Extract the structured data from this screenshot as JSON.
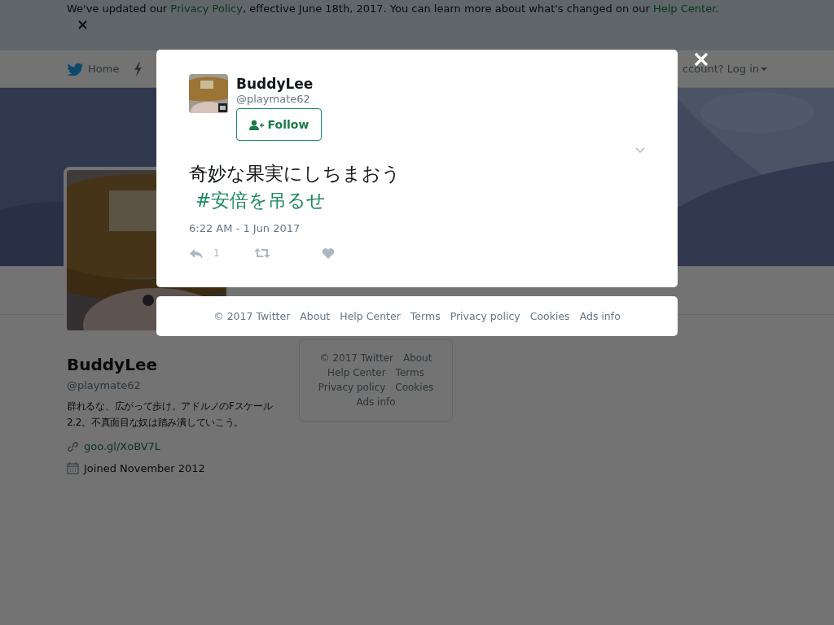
{
  "banner": {
    "message_parts": [
      {
        "kind": "text",
        "text": "We've updated our "
      },
      {
        "kind": "link",
        "text": "Privacy Policy"
      },
      {
        "kind": "text",
        "text": ", effective June 18th, 2017. You can learn more about what's changed on our "
      },
      {
        "kind": "link",
        "text": "Help Center"
      },
      {
        "kind": "text",
        "text": "."
      }
    ]
  },
  "nav": {
    "items": [
      {
        "label": "Home"
      }
    ],
    "login": "ccount? Log in"
  },
  "profile": {
    "name": "BuddyLee",
    "handle": "@playmate62",
    "bio": "群れるな、広がって歩け。アドルノのFスケール2.2。不真面目な奴は踏み潰していこう。",
    "link": "goo.gl/XoBV7L",
    "joined": "Joined November 2012"
  },
  "sidebar_footer": {
    "links": [
      "© 2017 Twitter",
      "About",
      "Help Center",
      "Terms",
      "Privacy policy",
      "Cookies",
      "Ads info"
    ]
  },
  "modal": {
    "tweet": {
      "name": "BuddyLee",
      "handle": "@playmate62",
      "follow_label": "Follow",
      "text": "奇妙な果実にしちまおう",
      "hashtag": "#安倍を吊るせ",
      "timestamp": "6:22 AM - 1 Jun 2017",
      "reply_count": "1"
    },
    "footer_links": [
      "© 2017 Twitter",
      "About",
      "Help Center",
      "Terms",
      "Privacy policy",
      "Cookies",
      "Ads info"
    ]
  }
}
